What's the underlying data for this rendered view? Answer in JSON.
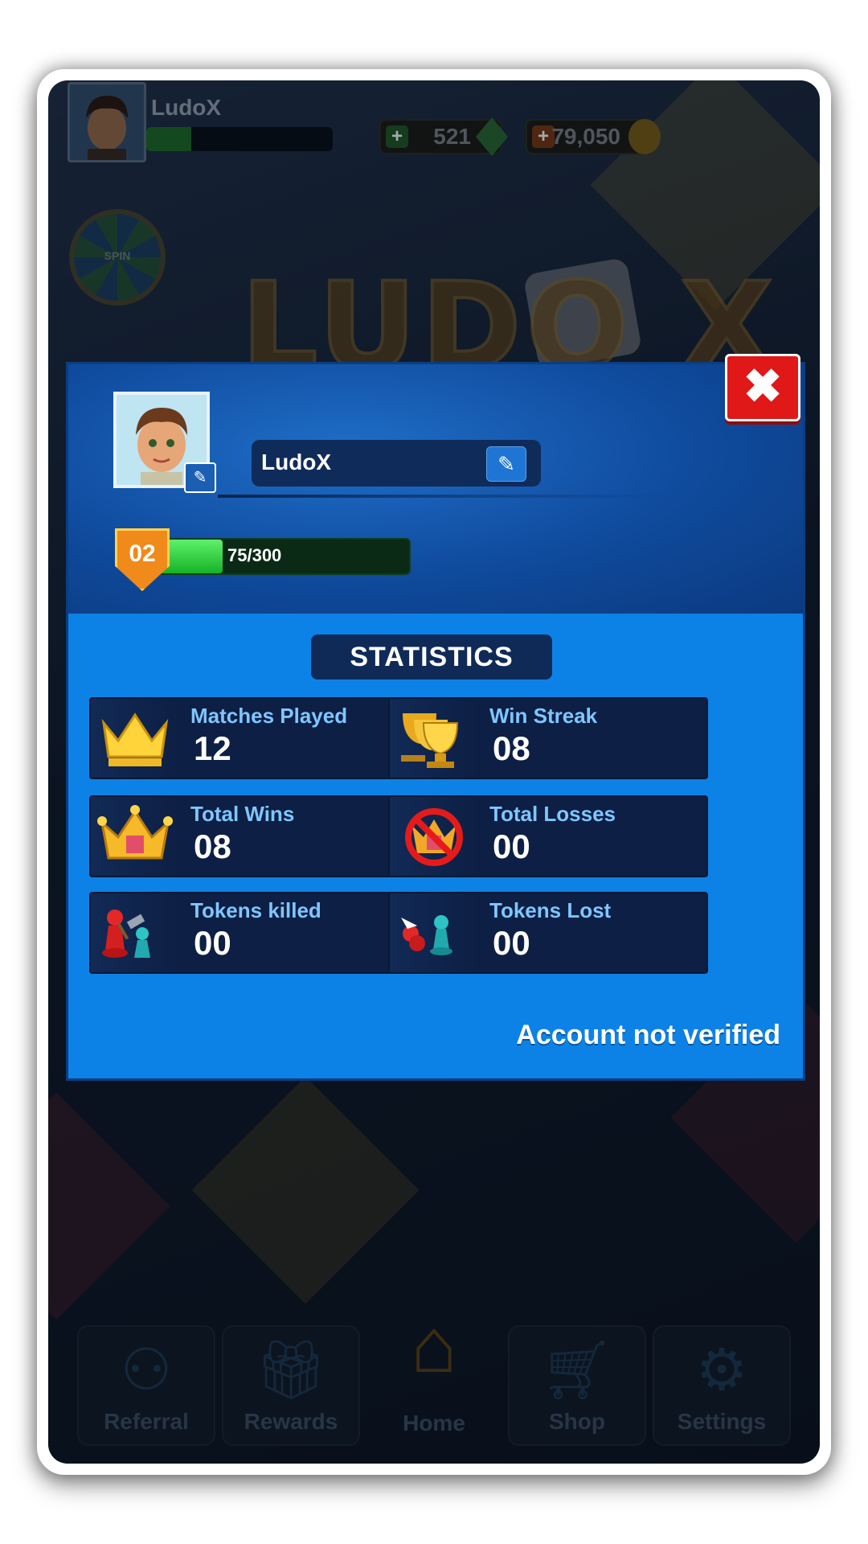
{
  "header": {
    "player_name": "LudoX",
    "xp_progress": 0.24,
    "gems": "521",
    "coins": "79,050",
    "spin_label": "SPIN",
    "logo_text": "LUDO X"
  },
  "nav": {
    "items": [
      {
        "label": "Referral",
        "icon": "referral-icon"
      },
      {
        "label": "Rewards",
        "icon": "gift-icon"
      },
      {
        "label": "Home",
        "icon": "home-icon"
      },
      {
        "label": "Shop",
        "icon": "cart-icon"
      },
      {
        "label": "Settings",
        "icon": "gear-icon"
      }
    ]
  },
  "profile": {
    "name": "LudoX",
    "level": "02",
    "xp_text": "75/300",
    "xp_progress": 0.25
  },
  "statistics": {
    "title": "STATISTICS",
    "items": [
      {
        "label": "Matches Played",
        "value": "12",
        "icon": "crown-icon"
      },
      {
        "label": "Win Streak",
        "value": "08",
        "icon": "trophy-icon"
      },
      {
        "label": "Total Wins",
        "value": "08",
        "icon": "jeweled-crown-icon"
      },
      {
        "label": "Total Losses",
        "value": "00",
        "icon": "no-crown-icon"
      },
      {
        "label": "Tokens killed",
        "value": "00",
        "icon": "hammer-token-icon"
      },
      {
        "label": "Tokens Lost",
        "value": "00",
        "icon": "broken-token-icon"
      }
    ]
  },
  "account_status": "Account not verified",
  "colors": {
    "panel_blue": "#0d82e6",
    "panel_dark": "#0d1f44",
    "label_cyan": "#7fc6ff",
    "close_red": "#e01818",
    "xp_green": "#15b226",
    "level_orange": "#f08a1a"
  }
}
